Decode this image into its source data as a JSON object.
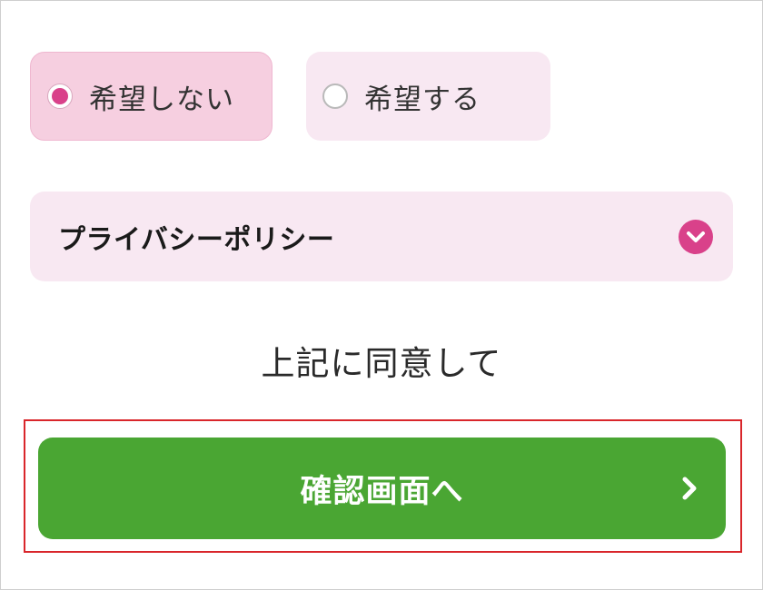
{
  "newsletter_options": {
    "options": [
      {
        "label": "希望しない",
        "selected": true
      },
      {
        "label": "希望する",
        "selected": false
      }
    ]
  },
  "privacy_policy": {
    "title": "プライバシーポリシー",
    "expand_icon": "chevron-down-icon",
    "expanded": false
  },
  "agreement": {
    "text": "上記に同意して"
  },
  "confirm_button": {
    "label": "確認画面へ",
    "icon": "chevron-right-icon"
  },
  "colors": {
    "accent_pink": "#d9418a",
    "selected_option_bg": "#f6cfe0",
    "option_bg": "#f8e8f2",
    "button_green": "#4aa633",
    "highlight_red": "#d9262b"
  }
}
